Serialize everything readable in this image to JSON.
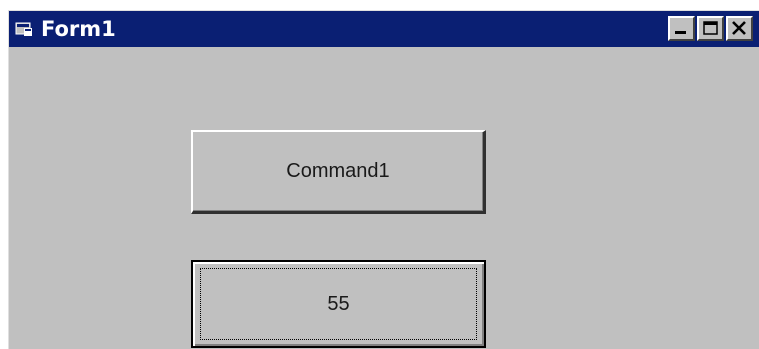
{
  "window": {
    "title": "Form1",
    "controls": {
      "minimize_icon": "minimize-icon",
      "maximize_icon": "maximize-icon",
      "close_icon": "close-icon"
    }
  },
  "form": {
    "command1_label": "Command1",
    "command2_label": "55"
  },
  "colors": {
    "titlebar": "#0a1f73",
    "face": "#c0c0c0"
  }
}
